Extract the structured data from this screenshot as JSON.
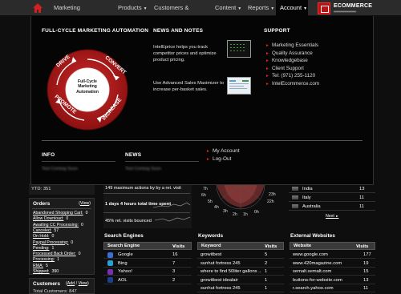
{
  "nav": {
    "items": [
      {
        "label": "Marketing Automation"
      },
      {
        "label": "Products"
      },
      {
        "label": "Customers & Orders"
      },
      {
        "label": "Content"
      },
      {
        "label": "Reports"
      },
      {
        "label": "Account"
      }
    ],
    "logo_text": "ECOMMERCE",
    "colors": {
      "bar": "#2b2b2b",
      "active": "#050505",
      "accent": "#cc1a1a"
    }
  },
  "menu": {
    "cycle": {
      "heading": "FULL-CYCLE MARKETING AUTOMATION",
      "center": [
        "Full-Cycle",
        "Marketing",
        "Automation"
      ],
      "segments": [
        "DRIVE",
        "CONVERT",
        "INCREASE",
        "PROMOTE"
      ]
    },
    "news_notes": {
      "heading": "NEWS AND NOTES",
      "items": [
        {
          "text": [
            "IntelEprice helps you track",
            "competitor prices and optimize",
            "product pricing."
          ]
        },
        {
          "text": [
            "Use Advanced Sales Maximizer to",
            "increase per-basket sales."
          ]
        }
      ]
    },
    "support": {
      "heading": "SUPPORT",
      "items": [
        "Marketing Essentials",
        "Quality Assurance",
        "Knowledgebase",
        "Client Support",
        "Tel: (971) 255-1120",
        "IntelEcommerce.com"
      ]
    },
    "info": {
      "heading": "INFO",
      "placeholder": "Text Coming Soon"
    },
    "news": {
      "heading": "NEWS",
      "placeholder": "Text Coming Soon"
    },
    "account_links": [
      "My Account",
      "Log-Out"
    ]
  },
  "left": {
    "ytd": "YTD: 351",
    "orders": {
      "title": "Orders",
      "view": "View",
      "rows": [
        {
          "label": "Abandoned Shopping Cart:",
          "value": "0"
        },
        {
          "label": "Allow Download:",
          "value": "0"
        },
        {
          "label": "Awaiting CC Processing:",
          "value": "0"
        },
        {
          "label": "Canceled:",
          "value": "57"
        },
        {
          "label": "On Hold:",
          "value": "0"
        },
        {
          "label": "Paypal Processing:",
          "value": "0"
        },
        {
          "label": "Pending:",
          "value": "1"
        },
        {
          "label": "Processed Back Order:",
          "value": "0"
        },
        {
          "label": "Processing:",
          "value": "1"
        },
        {
          "label": "RMA:",
          "value": "5"
        },
        {
          "label": "Shipped:",
          "value": "390"
        }
      ]
    },
    "customers": {
      "title": "Customers",
      "add": "Add",
      "view": "View",
      "total": "Total Customers: 847"
    }
  },
  "visits": {
    "lines": [
      "149 maximum actions by by a ret. visit",
      "1 days 4 hours total time spent",
      "45% ret. visits bounced"
    ]
  },
  "clock": {
    "hours": [
      "7h",
      "6h",
      "5h",
      "4h",
      "3h",
      "2h",
      "1h",
      "0h",
      "23h",
      "22h"
    ]
  },
  "countries": {
    "rows": [
      {
        "name": "India",
        "value": "13"
      },
      {
        "name": "Italy",
        "value": "11"
      },
      {
        "name": "Australia",
        "value": "11"
      }
    ],
    "next": "Next"
  },
  "search_engines": {
    "title": "Search Engines",
    "headers": [
      "Search Engine",
      "Visits"
    ],
    "rows": [
      {
        "name": "Google",
        "value": "16",
        "color": "#3b6fd6"
      },
      {
        "name": "Bing",
        "value": "7",
        "color": "#2a9fd6"
      },
      {
        "name": "Yahoo!",
        "value": "3",
        "color": "#7b2fb0"
      },
      {
        "name": "AOL",
        "value": "2",
        "color": "#1c3f8f"
      }
    ]
  },
  "keywords": {
    "title": "Keywords",
    "headers": [
      "Keyword",
      "Visits"
    ],
    "rows": [
      {
        "name": "growitbest",
        "value": "5"
      },
      {
        "name": "sunhut fortress 245",
        "value": "2"
      },
      {
        "name": "where to find 50liter gallons ...",
        "value": "1"
      },
      {
        "name": "growitbest idealair",
        "value": "1"
      },
      {
        "name": "sunhut fortress 245",
        "value": "1"
      }
    ]
  },
  "external": {
    "title": "External Websites",
    "headers": [
      "Website",
      "Visits"
    ],
    "rows": [
      {
        "name": "www.google.com",
        "value": "177"
      },
      {
        "name": "www.420magazine.com",
        "value": "19"
      },
      {
        "name": "semalt.semalt.com",
        "value": "15"
      },
      {
        "name": "buttons-for-website.com",
        "value": "13"
      },
      {
        "name": "r.search.yahoo.com",
        "value": "11"
      }
    ]
  }
}
